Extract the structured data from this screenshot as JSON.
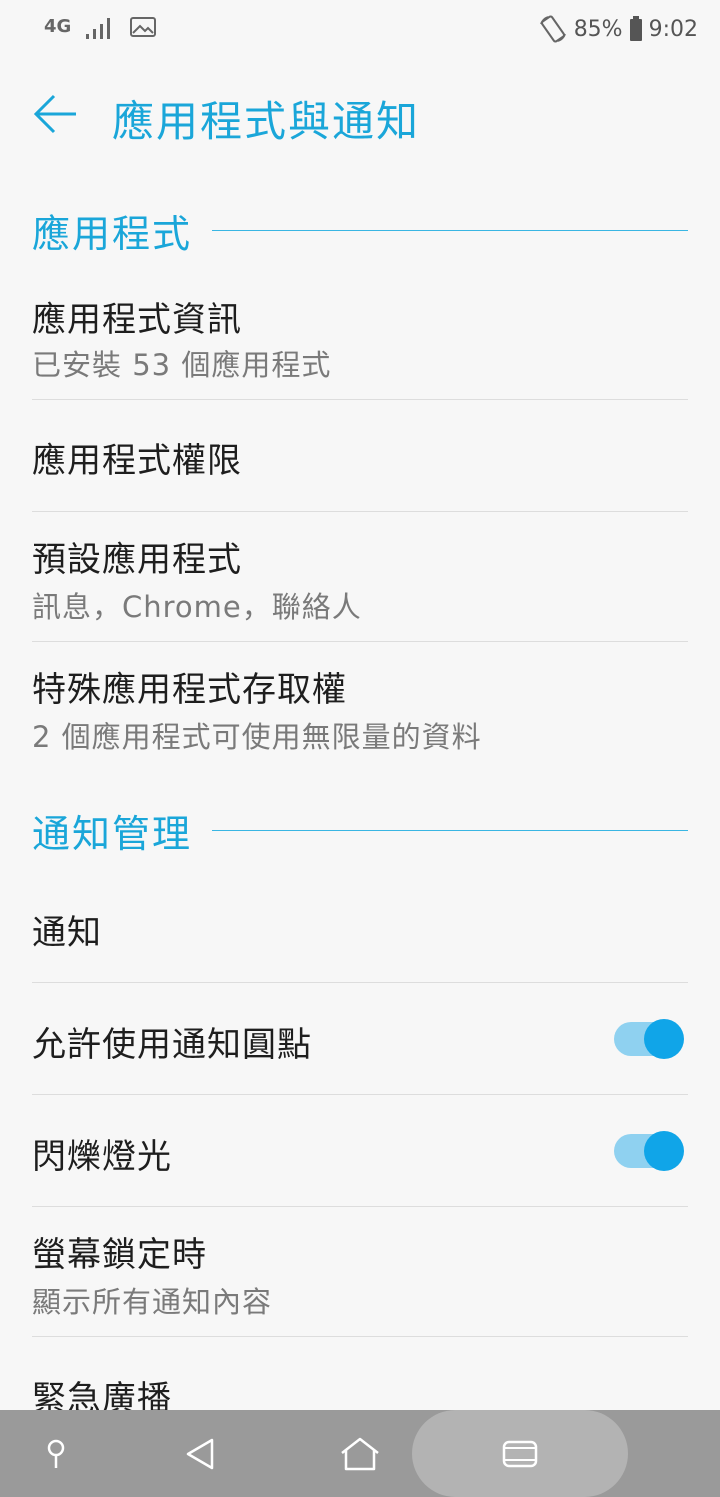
{
  "status_bar": {
    "network": "4G",
    "battery": "85%",
    "time": "9:02"
  },
  "app_bar": {
    "title": "應用程式與通知"
  },
  "sections": {
    "apps": {
      "title": "應用程式",
      "items": [
        {
          "title": "應用程式資訊",
          "subtitle": "已安裝 53 個應用程式"
        },
        {
          "title": "應用程式權限"
        },
        {
          "title": "預設應用程式",
          "subtitle": "訊息，Chrome，聯絡人"
        },
        {
          "title": "特殊應用程式存取權",
          "subtitle": "2 個應用程式可使用無限量的資料"
        }
      ]
    },
    "notifications": {
      "title": "通知管理",
      "items": [
        {
          "title": "通知"
        },
        {
          "title": "允許使用通知圓點",
          "toggle_on": true
        },
        {
          "title": "閃爍燈光",
          "toggle_on": true
        },
        {
          "title": "螢幕鎖定時",
          "subtitle": "顯示所有通知內容"
        },
        {
          "title": "緊急廣播"
        }
      ]
    }
  },
  "colors": {
    "accent": "#1aa6d9",
    "toggle_thumb": "#10a5e8",
    "toggle_track": "#8fd1f0",
    "nav_bar": "#9a9a9a"
  },
  "nav_bar": {
    "icons": [
      "search-icon",
      "back-icon",
      "home-icon",
      "recents-icon"
    ]
  }
}
